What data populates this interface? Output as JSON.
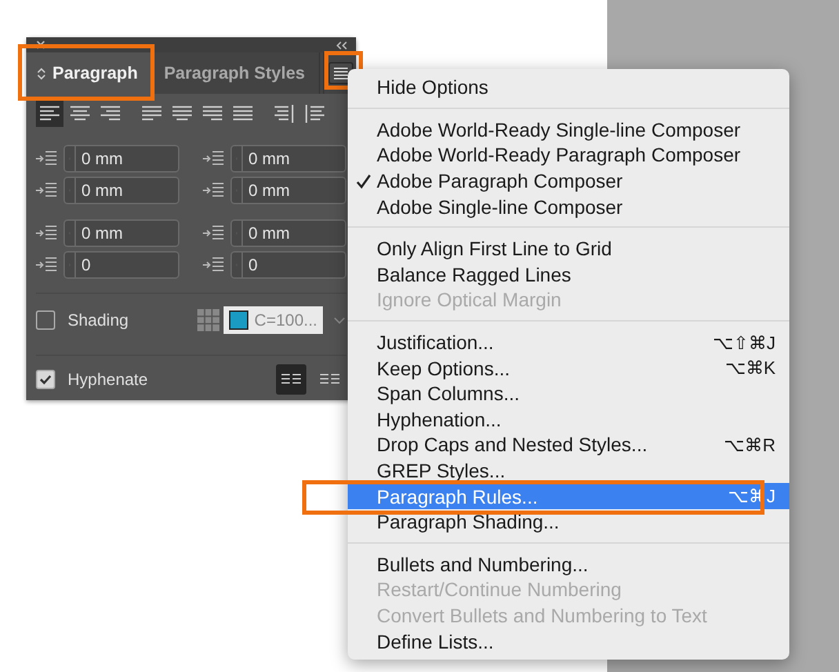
{
  "panel": {
    "tabs": [
      {
        "label": "Paragraph",
        "selected": true,
        "highlighted": true
      },
      {
        "label": "Paragraph Styles",
        "selected": false,
        "highlighted": false
      }
    ],
    "menu_button": {
      "highlighted": true
    },
    "alignment_buttons": [
      {
        "kind": "left",
        "selected": true
      },
      {
        "kind": "center",
        "selected": false
      },
      {
        "kind": "right",
        "selected": false
      },
      {
        "kind": "justify-left",
        "selected": false
      },
      {
        "kind": "justify-center",
        "selected": false
      },
      {
        "kind": "justify-right",
        "selected": false
      },
      {
        "kind": "justify-all",
        "selected": false
      },
      {
        "kind": "towards-spine",
        "selected": false
      },
      {
        "kind": "away-spine",
        "selected": false
      }
    ],
    "field_rows": [
      [
        {
          "value": "0 mm"
        },
        {
          "value": "0 mm"
        }
      ],
      [
        {
          "value": "0 mm"
        },
        {
          "value": "0 mm"
        }
      ],
      [
        {
          "value": "0 mm"
        },
        {
          "value": "0 mm"
        }
      ],
      [
        {
          "value": "0"
        },
        {
          "value": "0"
        }
      ]
    ],
    "shading": {
      "label": "Shading",
      "checked": false,
      "swatch_label": "C=100..."
    },
    "hyphenate": {
      "label": "Hyphenate",
      "checked": true
    },
    "composer_buttons": [
      {
        "selected": true
      },
      {
        "selected": false
      }
    ]
  },
  "menu": {
    "groups": [
      [
        {
          "label": "Hide Options",
          "checked": false,
          "disabled": false,
          "selected": false,
          "highlighted": false
        }
      ],
      [
        {
          "label": "Adobe World-Ready Single-line Composer",
          "checked": false,
          "disabled": false,
          "selected": false,
          "highlighted": false
        },
        {
          "label": "Adobe World-Ready Paragraph Composer",
          "checked": false,
          "disabled": false,
          "selected": false,
          "highlighted": false
        },
        {
          "label": "Adobe Paragraph Composer",
          "checked": true,
          "disabled": false,
          "selected": false,
          "highlighted": false
        },
        {
          "label": "Adobe Single-line Composer",
          "checked": false,
          "disabled": false,
          "selected": false,
          "highlighted": false
        }
      ],
      [
        {
          "label": "Only Align First Line to Grid",
          "checked": false,
          "disabled": false,
          "selected": false,
          "highlighted": false
        },
        {
          "label": "Balance Ragged Lines",
          "checked": false,
          "disabled": false,
          "selected": false,
          "highlighted": false
        },
        {
          "label": "Ignore Optical Margin",
          "checked": false,
          "disabled": true,
          "selected": false,
          "highlighted": false
        }
      ],
      [
        {
          "label": "Justification...",
          "shortcut": "⌥⇧⌘J",
          "checked": false,
          "disabled": false,
          "selected": false,
          "highlighted": false
        },
        {
          "label": "Keep Options...",
          "shortcut": "⌥⌘K",
          "checked": false,
          "disabled": false,
          "selected": false,
          "highlighted": false
        },
        {
          "label": "Span Columns...",
          "checked": false,
          "disabled": false,
          "selected": false,
          "highlighted": false
        },
        {
          "label": "Hyphenation...",
          "checked": false,
          "disabled": false,
          "selected": false,
          "highlighted": false
        },
        {
          "label": "Drop Caps and Nested Styles...",
          "shortcut": "⌥⌘R",
          "checked": false,
          "disabled": false,
          "selected": false,
          "highlighted": false
        },
        {
          "label": "GREP Styles...",
          "checked": false,
          "disabled": false,
          "selected": false,
          "highlighted": false
        },
        {
          "label": "Paragraph Rules...",
          "shortcut": "⌥⌘J",
          "checked": false,
          "disabled": false,
          "selected": true,
          "highlighted": true
        },
        {
          "label": "Paragraph Shading...",
          "checked": false,
          "disabled": false,
          "selected": false,
          "highlighted": false
        }
      ],
      [
        {
          "label": "Bullets and Numbering...",
          "checked": false,
          "disabled": false,
          "selected": false,
          "highlighted": false
        },
        {
          "label": "Restart/Continue Numbering",
          "checked": false,
          "disabled": true,
          "selected": false,
          "highlighted": false
        },
        {
          "label": "Convert Bullets and Numbering to Text",
          "checked": false,
          "disabled": true,
          "selected": false,
          "highlighted": false
        },
        {
          "label": "Define Lists...",
          "checked": false,
          "disabled": false,
          "selected": false,
          "highlighted": false
        }
      ]
    ]
  }
}
